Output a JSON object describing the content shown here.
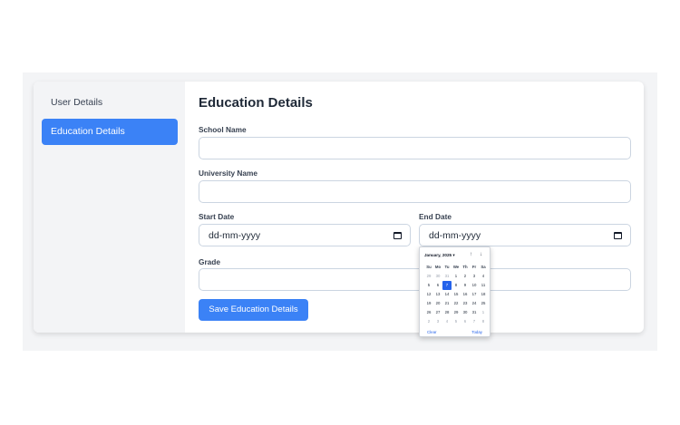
{
  "sidebar": {
    "items": [
      {
        "label": "User Details",
        "active": false
      },
      {
        "label": "Education Details",
        "active": true
      }
    ]
  },
  "form": {
    "title": "Education Details",
    "school_label": "School Name",
    "school_value": "",
    "university_label": "University Name",
    "university_value": "",
    "start_label": "Start Date",
    "start_placeholder": "dd-mm-yyyy",
    "end_label": "End Date",
    "end_placeholder": "dd-mm-yyyy",
    "grade_label": "Grade",
    "grade_value": "",
    "save_label": "Save Education Details"
  },
  "datepicker": {
    "month_label": "January, 2025 ▾",
    "weekdays": [
      "Su",
      "Mo",
      "Tu",
      "We",
      "Th",
      "Fr",
      "Sa"
    ],
    "days": [
      {
        "d": "29",
        "other": true
      },
      {
        "d": "30",
        "other": true
      },
      {
        "d": "31",
        "other": true
      },
      {
        "d": "1"
      },
      {
        "d": "2"
      },
      {
        "d": "3"
      },
      {
        "d": "4"
      },
      {
        "d": "5"
      },
      {
        "d": "6"
      },
      {
        "d": "7",
        "selected": true
      },
      {
        "d": "8"
      },
      {
        "d": "9"
      },
      {
        "d": "10"
      },
      {
        "d": "11"
      },
      {
        "d": "12"
      },
      {
        "d": "13"
      },
      {
        "d": "14"
      },
      {
        "d": "15"
      },
      {
        "d": "16"
      },
      {
        "d": "17"
      },
      {
        "d": "18"
      },
      {
        "d": "19"
      },
      {
        "d": "20"
      },
      {
        "d": "21"
      },
      {
        "d": "22"
      },
      {
        "d": "23"
      },
      {
        "d": "24"
      },
      {
        "d": "25"
      },
      {
        "d": "26"
      },
      {
        "d": "27"
      },
      {
        "d": "28"
      },
      {
        "d": "29"
      },
      {
        "d": "30"
      },
      {
        "d": "31"
      },
      {
        "d": "1",
        "other": true
      },
      {
        "d": "2",
        "other": true
      },
      {
        "d": "3",
        "other": true
      },
      {
        "d": "4",
        "other": true
      },
      {
        "d": "5",
        "other": true
      },
      {
        "d": "6",
        "other": true
      },
      {
        "d": "7",
        "other": true
      },
      {
        "d": "8",
        "other": true
      }
    ],
    "up_icon": "↑",
    "down_icon": "↓",
    "clear_label": "Clear",
    "today_label": "Today"
  },
  "colors": {
    "accent": "#3b82f6",
    "selected_day": "#2563eb"
  }
}
